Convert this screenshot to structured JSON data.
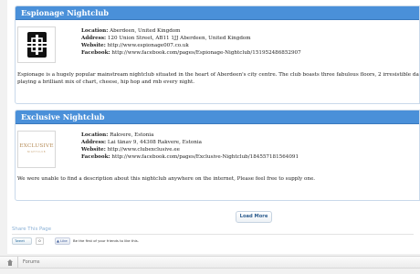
{
  "clubs": [
    {
      "title": "Espionage Nightclub",
      "logo_icon": "espionage-logo",
      "location_label": "Location:",
      "location": "Aberdeen, United Kingdom",
      "address_label": "Address:",
      "address": "120 Union Street, AB11 1JJ Aberdeen, United Kingdom",
      "website_label": "Website:",
      "website": "http://www.espionage007.co.uk",
      "facebook_label": "Facebook:",
      "facebook": "http://www.facebook.com/pages/Espionage-Nightclub/151952486852907",
      "description_lines": [
        "Espionage is a hugely popular mainstream nightclub situated in the heart of Aberdeen's city centre. The club boasts three fabulous floors, 2 irresistible dance floors and 4 extrav",
        "playing a brilliant mix of chart, cheese, hip hop and rnb every night."
      ]
    },
    {
      "title": "Exclusive Nightclub",
      "logo_icon": "exclusive-logo",
      "logo_text": "EXCLUSIVE",
      "logo_subtext": "NIGHTCLUB",
      "location_label": "Location:",
      "location": "Rakvere, Estonia",
      "address_label": "Address:",
      "address": "Lai tänav 9, 44308 Rakvere, Estonia",
      "website_label": "Website:",
      "website": "http://www.clubexclusive.ee",
      "facebook_label": "Facebook:",
      "facebook": "http://www.facebook.com/pages/Exclusive-Nightclub/184557181564091",
      "description_lines": [
        "We were unable to find a description about this nightclub anywhere on the internet, Please feel free to supply one."
      ]
    }
  ],
  "load_more_label": "Load More",
  "share": {
    "title": "Share This Page",
    "tweet_label": "Tweet",
    "tweet_count": "0",
    "like_label": "Like",
    "like_prompt": "Be the first of your friends to like this."
  },
  "breadcrumb": {
    "home_icon": "home-icon",
    "items": [
      "Forums"
    ]
  },
  "colors": {
    "header_blue": "#4a90d9",
    "card_border": "#c9d9ea",
    "link_blue": "#2e5d8f"
  }
}
